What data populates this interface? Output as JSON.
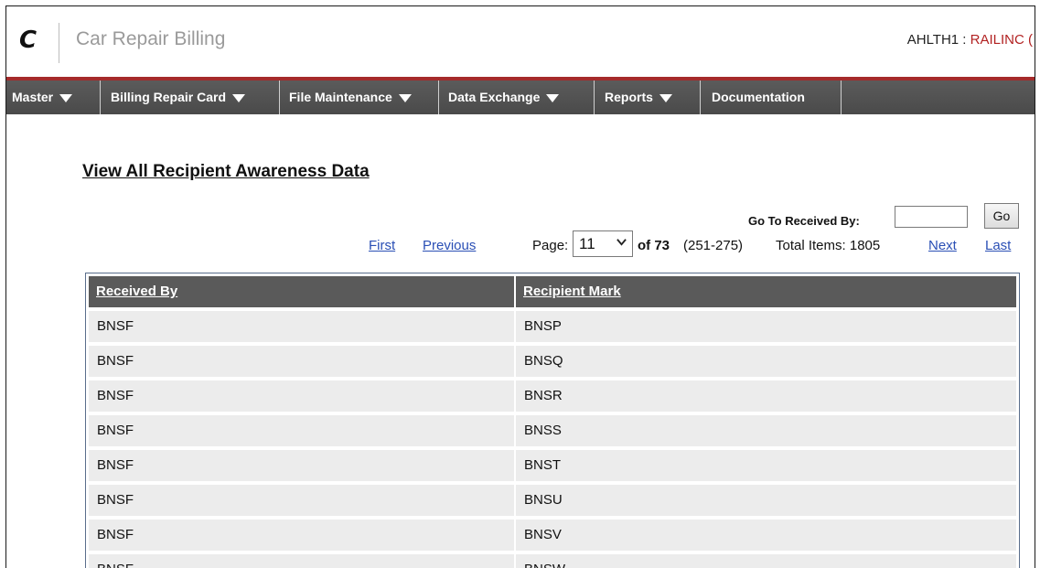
{
  "header": {
    "logo": "C",
    "app_title": "Car Repair Billing",
    "user_id": "AHLTH1",
    "user_sep": " : ",
    "user_org": "RAILINC ("
  },
  "nav": {
    "items": [
      {
        "label": "Master"
      },
      {
        "label": "Billing Repair Card"
      },
      {
        "label": "File Maintenance"
      },
      {
        "label": "Data Exchange"
      },
      {
        "label": "Reports"
      },
      {
        "label": "Documentation"
      }
    ]
  },
  "page": {
    "title": "View All Recipient Awareness Data",
    "goto_label": "Go To Received By:",
    "goto_value": "",
    "go_button": "Go"
  },
  "pager": {
    "first": "First",
    "previous": "Previous",
    "page_label": "Page:",
    "current_page": "11",
    "of_label": "of 73",
    "range": "(251-275)",
    "total_label": "Total Items: 1805",
    "next": "Next",
    "last": "Last"
  },
  "table": {
    "columns": [
      "Received By",
      "Recipient Mark"
    ],
    "rows": [
      [
        "BNSF",
        "BNSP"
      ],
      [
        "BNSF",
        "BNSQ"
      ],
      [
        "BNSF",
        "BNSR"
      ],
      [
        "BNSF",
        "BNSS"
      ],
      [
        "BNSF",
        "BNST"
      ],
      [
        "BNSF",
        "BNSU"
      ],
      [
        "BNSF",
        "BNSV"
      ],
      [
        "BNSF",
        "BNSW"
      ]
    ]
  },
  "icons": {
    "nav_caret": "caret-down-icon",
    "select_chevron": "chevron-down-icon"
  }
}
